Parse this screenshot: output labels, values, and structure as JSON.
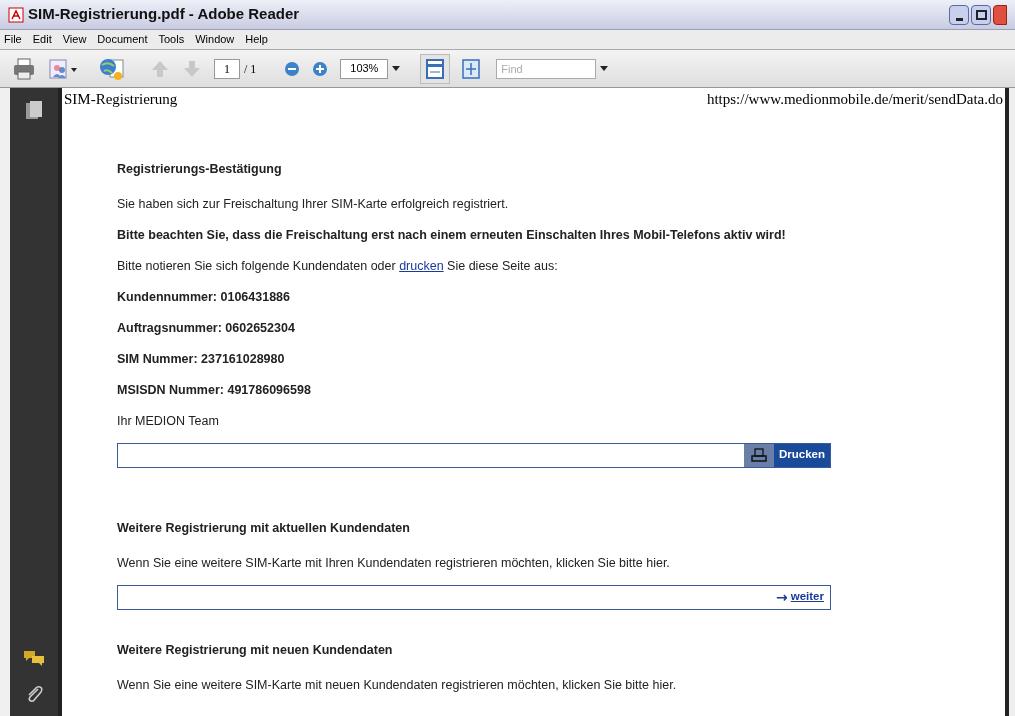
{
  "window": {
    "title": "SIM-Registrierung.pdf - Adobe Reader"
  },
  "menu": [
    "File",
    "Edit",
    "View",
    "Document",
    "Tools",
    "Window",
    "Help"
  ],
  "toolbar": {
    "page": "1",
    "page_total": "/ 1",
    "zoom": "103%",
    "find_placeholder": "Find"
  },
  "document": {
    "header_left": "SIM-Registrierung",
    "header_right": "https://www.medionmobile.de/merit/sendData.do",
    "blocks": [
      {
        "kind": "heading",
        "text": "Registrierungs-Bestätigung"
      },
      {
        "kind": "text",
        "text": "Sie haben sich zur Freischaltung Ihrer SIM-Karte erfolgreich registriert."
      },
      {
        "kind": "bold",
        "text": "Bitte beachten Sie, dass die Freischaltung erst nach einem erneuten Einschalten Ihres Mobil-Telefons aktiv wird!"
      },
      {
        "kind": "linktext",
        "before": "Bitte notieren Sie sich folgende Kundendaten oder",
        "link": "drucken",
        "after": "Sie diese Seite aus:"
      },
      {
        "kind": "bold",
        "text": "Kundennummer: 0106431886"
      },
      {
        "kind": "bold",
        "text": "Auftragsnummer: 0602652304"
      },
      {
        "kind": "bold",
        "text": "SIM Nummer: 237161028980"
      },
      {
        "kind": "bold",
        "text": "MSISDN Nummer: 491786096598"
      },
      {
        "kind": "text",
        "text": "Ihr MEDION Team"
      },
      {
        "kind": "printbar",
        "label": "Drucken"
      },
      {
        "kind": "heading",
        "text": "Weitere Registrierung mit aktuellen Kundendaten"
      },
      {
        "kind": "text",
        "text": "Wenn Sie eine weitere SIM-Karte mit Ihren Kundendaten registrieren möchten, klicken Sie bitte hier."
      },
      {
        "kind": "nextbar",
        "arrow": "→",
        "label": "weiter"
      },
      {
        "kind": "heading",
        "text": "Weitere Registrierung mit neuen Kundendaten"
      },
      {
        "kind": "text",
        "text": "Wenn Sie eine weitere SIM-Karte mit neuen Kundendaten registrieren möchten, klicken Sie bitte hier."
      }
    ]
  }
}
